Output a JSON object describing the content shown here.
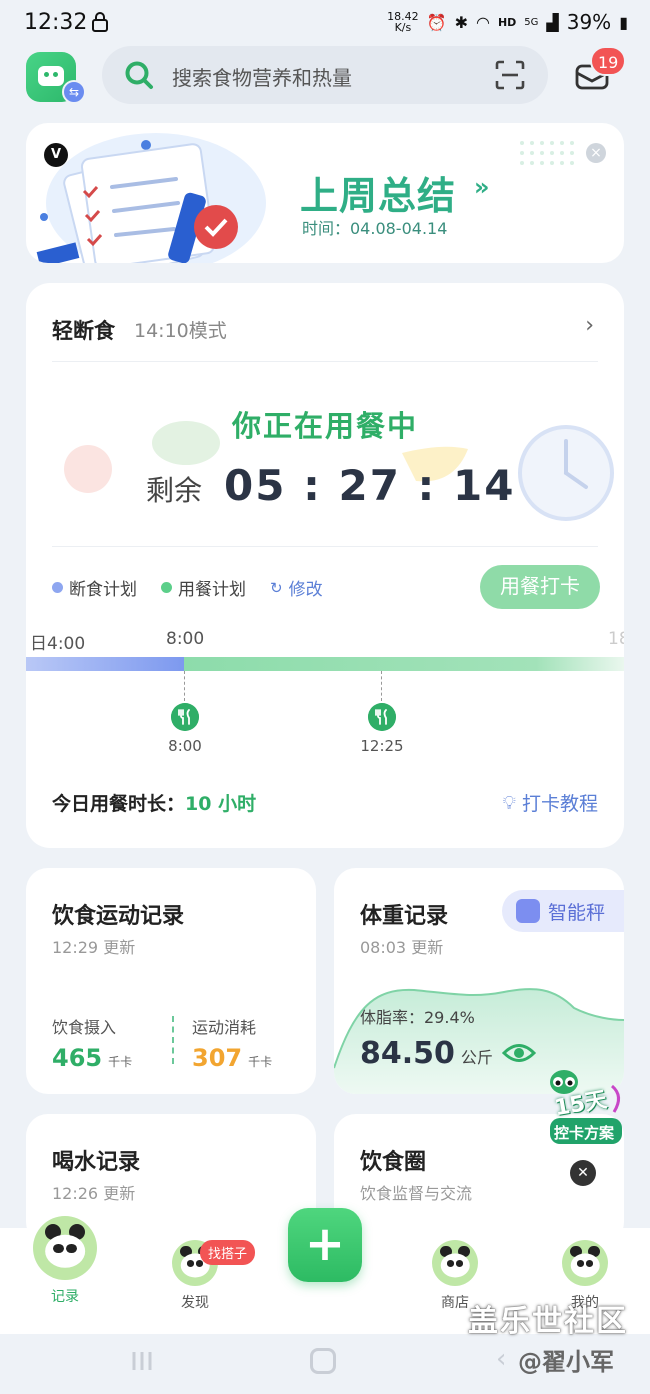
{
  "status_bar": {
    "time": "12:32",
    "net_speed_value": "18.42",
    "net_speed_unit": "K/s",
    "hd": "HD",
    "signal": "5G",
    "battery": "39%"
  },
  "top_bar": {
    "search_placeholder": "搜索食物营养和热量",
    "mail_count": "19"
  },
  "banner": {
    "title": "上周总结",
    "arrow": "»",
    "time_text": "时间：04.08-04.14",
    "logo": "V"
  },
  "fasting": {
    "title": "轻断食",
    "mode": "14:10模式",
    "status": "你正在用餐中",
    "remain_label": "剩余",
    "remain_time": "05 : 27 : 14",
    "legend_fast": "断食计划",
    "legend_eat": "用餐计划",
    "modify": "修改",
    "checkin_button": "用餐打卡",
    "timeline_labels": [
      "日4:00",
      "8:00",
      "18"
    ],
    "meals": [
      {
        "time": "8:00"
      },
      {
        "time": "12:25"
      }
    ],
    "today_label": "今日用餐时长：",
    "today_value": "10 小时",
    "tutorial": "打卡教程",
    "colors": {
      "fast": "#7d99ef",
      "eat": "#5ccf8a",
      "accent": "#2fae67"
    }
  },
  "diet_card": {
    "title": "饮食运动记录",
    "updated": "12:29 更新",
    "intake_label": "饮食摄入",
    "intake_value": "465",
    "intake_unit": "千卡",
    "burn_label": "运动消耗",
    "burn_value": "307",
    "burn_unit": "千卡"
  },
  "weight_card": {
    "title": "体重记录",
    "updated": "08:03 更新",
    "scale_button": "智能秤",
    "fat_rate": "体脂率：29.4%",
    "weight": "84.50",
    "unit": "公斤"
  },
  "water_card": {
    "title": "喝水记录",
    "updated": "12:26 更新"
  },
  "circle_card": {
    "title": "饮食圈",
    "subtitle": "饮食监督与交流"
  },
  "promo": {
    "days": "15天",
    "label": "控卡方案"
  },
  "bottom_nav": {
    "items": [
      {
        "label": "记录"
      },
      {
        "label": "发现"
      },
      {
        "label": "商店"
      },
      {
        "label": "我的"
      }
    ],
    "find_badge": "找搭子",
    "plus": "+"
  },
  "watermark": {
    "line1": "盖乐世社区",
    "line2": "@翟小军"
  }
}
